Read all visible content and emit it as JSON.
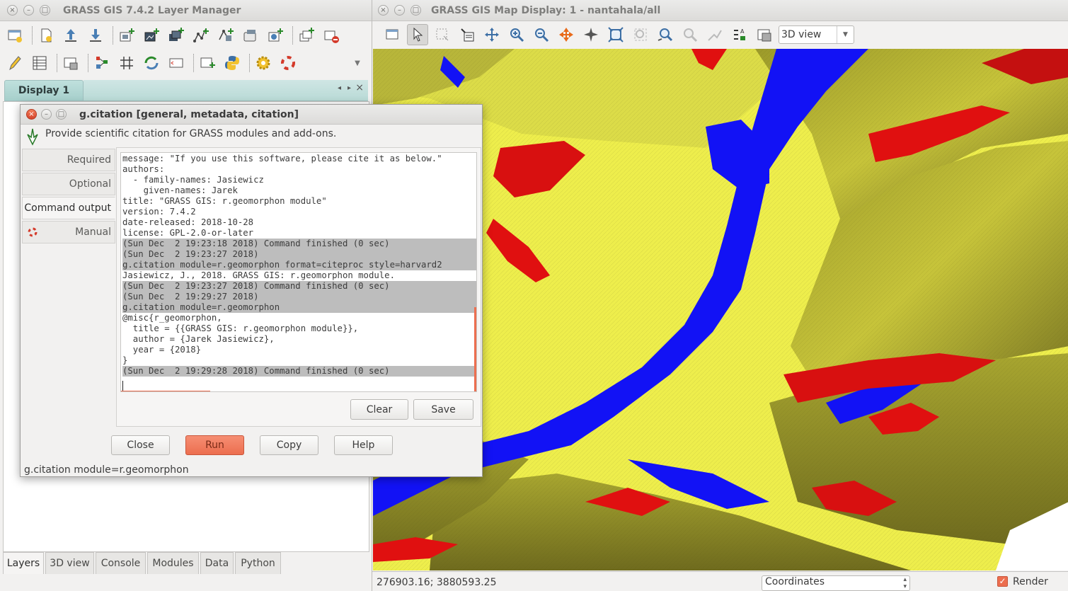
{
  "layer_manager": {
    "title": "GRASS GIS 7.4.2 Layer Manager",
    "display_tab": "Display 1",
    "bottom_tabs": [
      "Layers",
      "3D view",
      "Console",
      "Modules",
      "Data",
      "Python"
    ]
  },
  "map_display": {
    "title": "GRASS GIS Map Display: 1 - nantahala/all",
    "view_select": "3D view",
    "coords": "276903.16; 3880593.25",
    "status_select": "Coordinates",
    "render_label": "Render",
    "render_checked": true
  },
  "dialog": {
    "title": "g.citation [general, metadata, citation]",
    "description": "Provide scientific citation for GRASS modules and add-ons.",
    "side_tabs": [
      "Required",
      "Optional",
      "Command output",
      "Manual"
    ],
    "active_tab": "Command output",
    "output_lines": [
      {
        "text": "message: \"If you use this software, please cite it as below.\"",
        "hl": false
      },
      {
        "text": "authors:",
        "hl": false
      },
      {
        "text": "  - family-names: Jasiewicz",
        "hl": false
      },
      {
        "text": "    given-names: Jarek",
        "hl": false
      },
      {
        "text": "title: \"GRASS GIS: r.geomorphon module\"",
        "hl": false
      },
      {
        "text": "version: 7.4.2",
        "hl": false
      },
      {
        "text": "date-released: 2018-10-28",
        "hl": false
      },
      {
        "text": "license: GPL-2.0-or-later",
        "hl": false
      },
      {
        "text": "(Sun Dec  2 19:23:18 2018) Command finished (0 sec)",
        "hl": true
      },
      {
        "text": "(Sun Dec  2 19:23:27 2018)",
        "hl": true
      },
      {
        "text": "g.citation module=r.geomorphon format=citeproc style=harvard2",
        "hl": true
      },
      {
        "text": "Jasiewicz, J., 2018. GRASS GIS: r.geomorphon module.",
        "hl": false
      },
      {
        "text": "(Sun Dec  2 19:23:27 2018) Command finished (0 sec)",
        "hl": true
      },
      {
        "text": "(Sun Dec  2 19:29:27 2018)",
        "hl": true
      },
      {
        "text": "g.citation module=r.geomorphon",
        "hl": true
      },
      {
        "text": "@misc{r_geomorphon,",
        "hl": false
      },
      {
        "text": "  title = {{GRASS GIS: r.geomorphon module}},",
        "hl": false
      },
      {
        "text": "  author = {Jarek Jasiewicz},",
        "hl": false
      },
      {
        "text": "  year = {2018}",
        "hl": false
      },
      {
        "text": "}",
        "hl": false
      },
      {
        "text": "(Sun Dec  2 19:29:28 2018) Command finished (0 sec)",
        "hl": true
      }
    ],
    "clear_label": "Clear",
    "save_label": "Save",
    "close_label": "Close",
    "run_label": "Run",
    "copy_label": "Copy",
    "help_label": "Help",
    "status": "g.citation module=r.geomorphon"
  },
  "colors": {
    "accent": "#ec6e4f",
    "terrain_yellow": "#f0f04a",
    "water_blue": "#1212f5",
    "ridge_red": "#e01010"
  }
}
